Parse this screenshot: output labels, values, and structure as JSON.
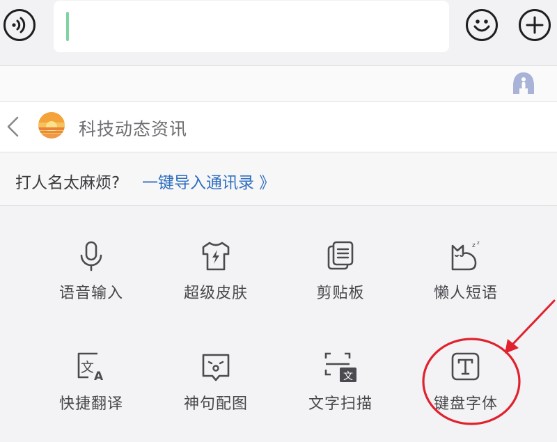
{
  "input_bar": {
    "icons": [
      "voice-icon",
      "emoji-icon",
      "plus-icon"
    ],
    "accent_color": "#7fd3a5"
  },
  "app_row": {
    "name": "科技动态资讯",
    "icons": [
      "chevron-left-icon",
      "sunset-avatar-icon"
    ]
  },
  "hint": {
    "text": "打人名太麻烦?",
    "link": "一键导入通讯录 》",
    "link_color": "#2f6fbf"
  },
  "tools": [
    {
      "label": "语音输入",
      "icon": "microphone-icon"
    },
    {
      "label": "超级皮肤",
      "icon": "tshirt-icon"
    },
    {
      "label": "剪贴板",
      "icon": "clipboard-icon"
    },
    {
      "label": "懒人短语",
      "icon": "sleepy-cat-icon"
    },
    {
      "label": "快捷翻译",
      "icon": "translate-icon"
    },
    {
      "label": "神句配图",
      "icon": "picture-face-icon"
    },
    {
      "label": "文字扫描",
      "icon": "scan-text-icon"
    },
    {
      "label": "键盘字体",
      "icon": "font-t-icon"
    }
  ],
  "annotation": {
    "color": "#e0212e"
  }
}
